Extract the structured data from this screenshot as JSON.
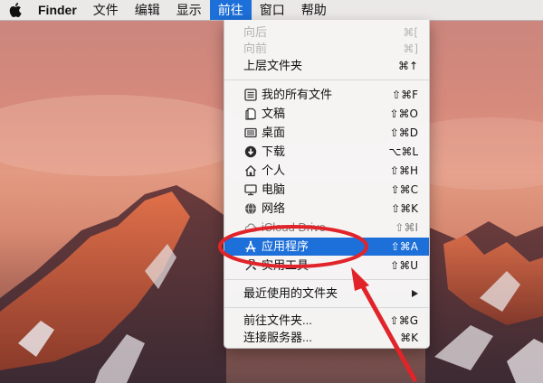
{
  "menubar": {
    "app_name": "Finder",
    "items": [
      "文件",
      "编辑",
      "显示",
      "前往",
      "窗口",
      "帮助"
    ],
    "active_index": 3
  },
  "go_menu": {
    "sections": [
      {
        "items": [
          {
            "label": "向后",
            "shortcut": "⌘[",
            "enabled": false
          },
          {
            "label": "向前",
            "shortcut": "⌘]",
            "enabled": false
          },
          {
            "label": "上层文件夹",
            "shortcut": "⌘↑",
            "enabled": true
          }
        ]
      },
      {
        "items": [
          {
            "label": "我的所有文件",
            "shortcut": "⇧⌘F",
            "icon": "all-files-icon"
          },
          {
            "label": "文稿",
            "shortcut": "⇧⌘O",
            "icon": "documents-icon"
          },
          {
            "label": "桌面",
            "shortcut": "⇧⌘D",
            "icon": "desktop-icon"
          },
          {
            "label": "下载",
            "shortcut": "⌥⌘L",
            "icon": "downloads-icon"
          },
          {
            "label": "个人",
            "shortcut": "⇧⌘H",
            "icon": "home-icon"
          },
          {
            "label": "电脑",
            "shortcut": "⇧⌘C",
            "icon": "computer-icon"
          },
          {
            "label": "网络",
            "shortcut": "⇧⌘K",
            "icon": "network-icon"
          },
          {
            "label": "iCloud Drive",
            "shortcut": "⇧⌘I",
            "icon": "icloud-icon"
          },
          {
            "label": "应用程序",
            "shortcut": "⇧⌘A",
            "icon": "applications-icon",
            "highlighted": true
          },
          {
            "label": "实用工具",
            "shortcut": "⇧⌘U",
            "icon": "utilities-icon"
          }
        ]
      },
      {
        "items": [
          {
            "label": "最近使用的文件夹",
            "submenu": true
          }
        ]
      },
      {
        "items": [
          {
            "label": "前往文件夹...",
            "shortcut": "⇧⌘G"
          },
          {
            "label": "连接服务器...",
            "shortcut": "⌘K"
          }
        ]
      }
    ]
  },
  "colors": {
    "highlight": "#1d6fd9",
    "annotation": "#e0242a",
    "disabled_text": "#b3b3b3"
  }
}
